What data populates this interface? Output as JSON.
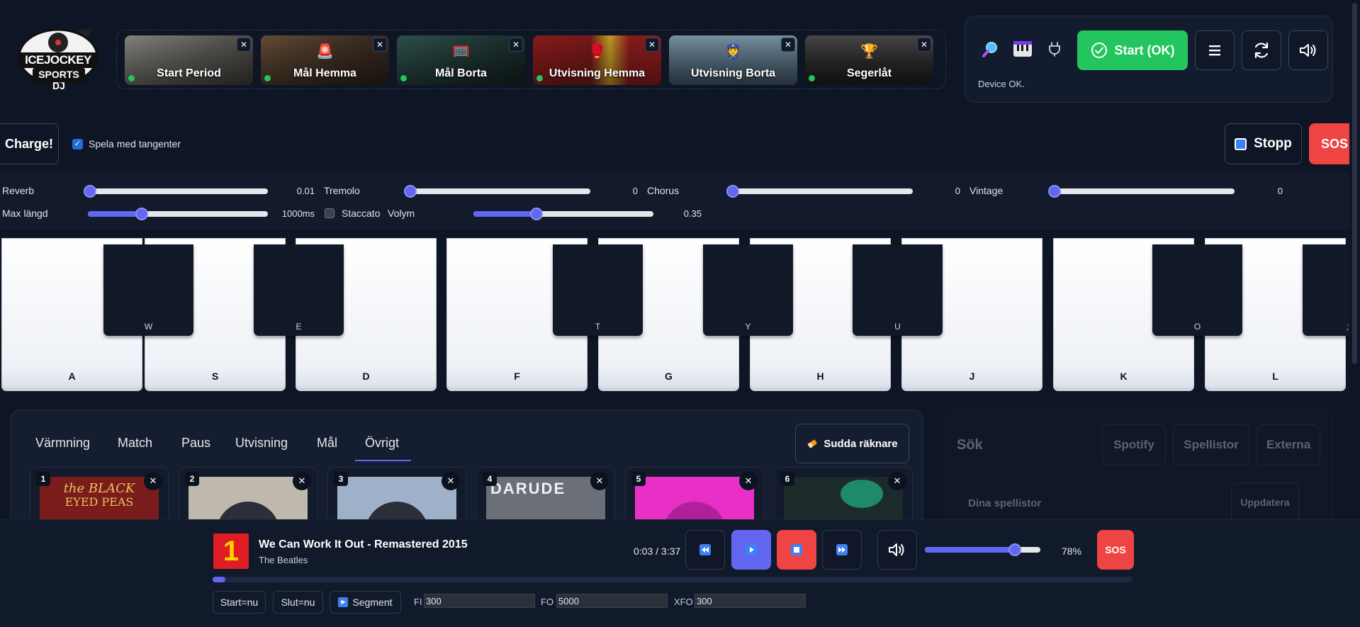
{
  "logo": {
    "line1": "ICEJOCKEY",
    "line2": "SPORTS DJ"
  },
  "hotkeys": [
    {
      "label": "Start Period",
      "icon": "player-photo",
      "color": "#6b6a66"
    },
    {
      "label": "Mål Hemma",
      "icon": "🚨",
      "color": "#4a3a2d"
    },
    {
      "label": "Mål Borta",
      "icon": "🥅",
      "color": "#23403f"
    },
    {
      "label": "Utvisning Hemma",
      "icon": "🥊",
      "color": "#7c1b1b"
    },
    {
      "label": "Utvisning Borta",
      "icon": "👮",
      "color": "#5a7587"
    },
    {
      "label": "Segerlåt",
      "icon": "🏆",
      "color": "#3a3a3a"
    }
  ],
  "device": {
    "start_label": "Start (OK)",
    "status": "Device OK."
  },
  "controls": {
    "charge_label": "Charge!",
    "keys_label": "Spela med tangenter",
    "keys_checked": true,
    "stop_label": "Stopp",
    "sos_label": "SOS"
  },
  "fx": {
    "reverb": {
      "label": "Reverb",
      "value": "0.01",
      "level": 0.01
    },
    "tremolo": {
      "label": "Tremolo",
      "value": "0",
      "level": 0
    },
    "chorus": {
      "label": "Chorus",
      "value": "0",
      "level": 0
    },
    "vintage": {
      "label": "Vintage",
      "value": "0",
      "level": 0
    },
    "maxlen": {
      "label": "Max längd",
      "value": "1000ms",
      "level": 0.3
    },
    "staccato": {
      "label": "Staccato",
      "checked": false
    },
    "volume": {
      "label": "Volym",
      "value": "0.35",
      "level": 0.35
    }
  },
  "piano": {
    "white_keys": [
      "A",
      "S",
      "D",
      "F",
      "G",
      "H",
      "J",
      "K",
      "L"
    ],
    "black_keys": [
      "W",
      "E",
      "T",
      "Y",
      "U",
      "O",
      ";"
    ]
  },
  "tabs": [
    "Värmning",
    "Match",
    "Paus",
    "Utvisning",
    "Mål",
    "Övrigt"
  ],
  "active_tab": "Övrigt",
  "clear_counters_label": "Sudda räknare",
  "cards": [
    {
      "num": "1",
      "art_color": "#7a1c1c"
    },
    {
      "num": "2",
      "art_color": "#bfb9ad"
    },
    {
      "num": "3",
      "art_color": "#9fb1c8"
    },
    {
      "num": "4",
      "art_color": "#6b6f78"
    },
    {
      "num": "5",
      "art_color": "#e830c7"
    },
    {
      "num": "6",
      "art_color": "#1c2a2a"
    }
  ],
  "search": {
    "title": "Sök",
    "spotify": "Spotify",
    "playlists": "Spellistor",
    "external": "Externa",
    "your_playlists": "Dina spellistor",
    "update": "Uppdatera"
  },
  "player": {
    "cover_text": "1",
    "title": "We Can Work It Out - Remastered 2015",
    "artist": "The Beatles",
    "time": "0:03 / 3:37",
    "volume_label": "78%",
    "volume_level": 0.78,
    "progress": 0.014,
    "sos_label": "SOS",
    "start_now": "Start=nu",
    "end_now": "Slut=nu",
    "segment": "Segment",
    "fi_label": "FI",
    "fi_value": "300",
    "fo_label": "FO",
    "fo_value": "5000",
    "xfo_label": "XFO",
    "xfo_value": "300"
  }
}
